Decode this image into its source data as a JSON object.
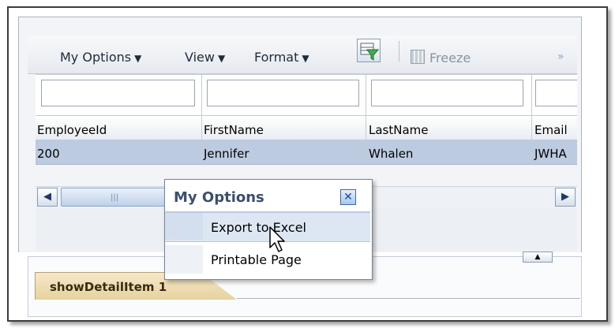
{
  "toolbar": {
    "menus": [
      "My Options",
      "View",
      "Format"
    ],
    "freeze_label": "Freeze",
    "more_symbol": "»"
  },
  "table": {
    "columns": [
      "EmployeeId",
      "FirstName",
      "LastName",
      "Email"
    ],
    "rows": [
      [
        "200",
        "Jennifer",
        "Whalen",
        "JWHA"
      ]
    ]
  },
  "popup": {
    "title": "My Options",
    "items": [
      "Export to Excel",
      "Printable Page"
    ],
    "highlighted_item": "Export to Excel"
  },
  "tab": {
    "label": "showDetailItem 1"
  },
  "icons": {
    "close": "close-icon",
    "filter": "query-filter-icon",
    "freeze": "freeze-columns-icon",
    "scroll_left": "scroll-left-icon",
    "scroll_right": "scroll-right-icon",
    "cursor": "mouse-pointer-icon"
  },
  "colors": {
    "selected_row": "#bccbe0",
    "popup_title": "#3a4e6e",
    "tab": "#e6d2a0"
  }
}
